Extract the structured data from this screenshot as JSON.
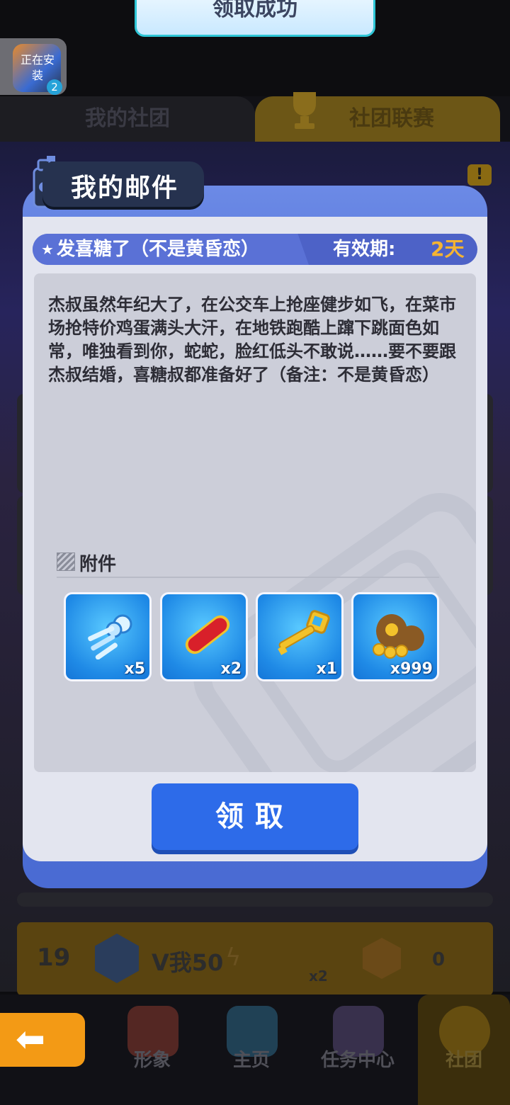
{
  "toast": {
    "text": "领取成功"
  },
  "install_badge": {
    "label": "正在安装",
    "count": "2"
  },
  "tabs": {
    "left": "我的社团",
    "right": "社团联赛"
  },
  "background_bar": {
    "rank": "19",
    "name": "V我50",
    "key_count": "x2",
    "score": "0"
  },
  "bottom_nav": {
    "items": [
      {
        "label": "形象",
        "icon": "character-icon"
      },
      {
        "label": "主页",
        "icon": "skateboard-map-icon"
      },
      {
        "label": "任务中心",
        "icon": "spray-cans-icon"
      },
      {
        "label": "社团",
        "icon": "club-mascot-icon"
      }
    ],
    "back_icon": "back-arrow-icon"
  },
  "mail": {
    "title": "我的邮件",
    "subject": "发喜糖了（不是黄昏恋）",
    "valid_label": "有效期:",
    "valid_value": "2天",
    "body": "杰叔虽然年纪大了，在公交车上抢座健步如飞，在菜市场抢特价鸡蛋满头大汗，在地铁跑酷上蹿下跳面色如常，唯独看到你，蛇蛇，脸红低头不敢说……要不要跟杰叔结婚，喜糖叔都准备好了（备注：不是黄昏恋）",
    "attach_label": "附件",
    "attachments": [
      {
        "name": "keys-icon",
        "count": "x5"
      },
      {
        "name": "hoverboard-icon",
        "count": "x2"
      },
      {
        "name": "golden-key-icon",
        "count": "x1"
      },
      {
        "name": "coin-bags-icon",
        "count": "x999"
      }
    ],
    "claim_label": "领取"
  },
  "colors": {
    "dialog_blue": "#4a6bd3",
    "button_blue": "#2d6be9",
    "valid_orange": "#f6b431",
    "back_orange": "#f39a15"
  }
}
